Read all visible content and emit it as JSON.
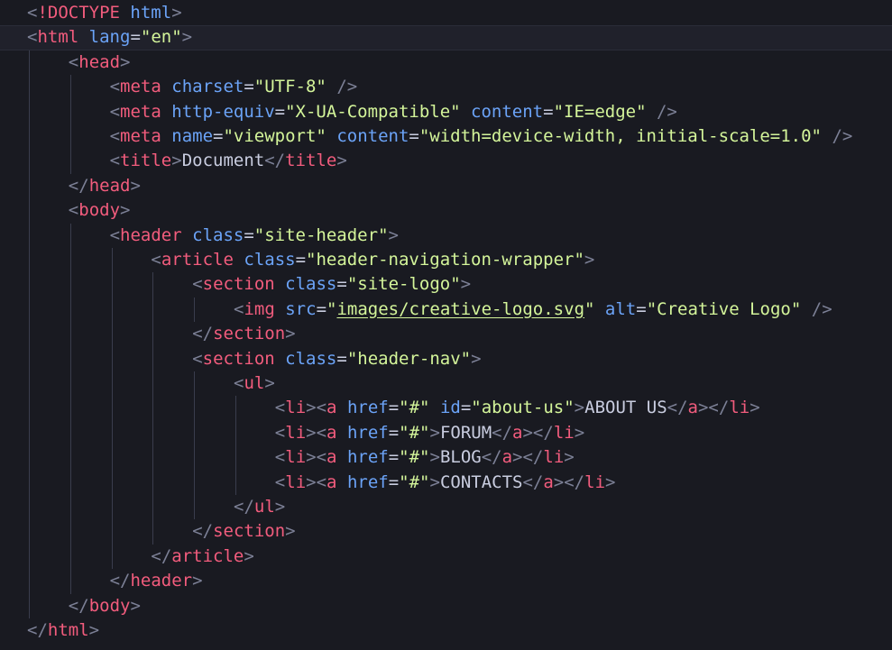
{
  "editor": {
    "language": "html",
    "active_line": 1,
    "colors": {
      "background": "#191a21",
      "tag": "#f25c7d",
      "attribute": "#6ba3f7",
      "string": "#d4f59a",
      "text": "#c9cde0",
      "punctuation": "#7c8096"
    },
    "lines": [
      {
        "indent": 0,
        "tokens": [
          [
            "punct",
            "<"
          ],
          [
            "tag",
            "!DOCTYPE"
          ],
          [
            "txt",
            " "
          ],
          [
            "attr",
            "html"
          ],
          [
            "punct",
            ">"
          ]
        ]
      },
      {
        "indent": 0,
        "tokens": [
          [
            "punct",
            "<"
          ],
          [
            "tag",
            "html"
          ],
          [
            "txt",
            " "
          ],
          [
            "attr",
            "lang"
          ],
          [
            "eq",
            "="
          ],
          [
            "str",
            "\"en\""
          ],
          [
            "punct",
            ">"
          ]
        ]
      },
      {
        "indent": 1,
        "tokens": [
          [
            "punct",
            "<"
          ],
          [
            "tag",
            "head"
          ],
          [
            "punct",
            ">"
          ]
        ]
      },
      {
        "indent": 2,
        "tokens": [
          [
            "punct",
            "<"
          ],
          [
            "tag",
            "meta"
          ],
          [
            "txt",
            " "
          ],
          [
            "attr",
            "charset"
          ],
          [
            "eq",
            "="
          ],
          [
            "str",
            "\"UTF-8\""
          ],
          [
            "txt",
            " "
          ],
          [
            "punct",
            "/>"
          ]
        ]
      },
      {
        "indent": 2,
        "tokens": [
          [
            "punct",
            "<"
          ],
          [
            "tag",
            "meta"
          ],
          [
            "txt",
            " "
          ],
          [
            "attr",
            "http-equiv"
          ],
          [
            "eq",
            "="
          ],
          [
            "str",
            "\"X-UA-Compatible\""
          ],
          [
            "txt",
            " "
          ],
          [
            "attr",
            "content"
          ],
          [
            "eq",
            "="
          ],
          [
            "str",
            "\"IE=edge\""
          ],
          [
            "txt",
            " "
          ],
          [
            "punct",
            "/>"
          ]
        ]
      },
      {
        "indent": 2,
        "tokens": [
          [
            "punct",
            "<"
          ],
          [
            "tag",
            "meta"
          ],
          [
            "txt",
            " "
          ],
          [
            "attr",
            "name"
          ],
          [
            "eq",
            "="
          ],
          [
            "str",
            "\"viewport\""
          ],
          [
            "txt",
            " "
          ],
          [
            "attr",
            "content"
          ],
          [
            "eq",
            "="
          ],
          [
            "str",
            "\"width=device-width, initial-scale=1.0\""
          ],
          [
            "txt",
            " "
          ],
          [
            "punct",
            "/>"
          ]
        ]
      },
      {
        "indent": 2,
        "tokens": [
          [
            "punct",
            "<"
          ],
          [
            "tag",
            "title"
          ],
          [
            "punct",
            ">"
          ],
          [
            "txt",
            "Document"
          ],
          [
            "punct",
            "</"
          ],
          [
            "tag",
            "title"
          ],
          [
            "punct",
            ">"
          ]
        ]
      },
      {
        "indent": 1,
        "tokens": [
          [
            "punct",
            "</"
          ],
          [
            "tag",
            "head"
          ],
          [
            "punct",
            ">"
          ]
        ]
      },
      {
        "indent": 1,
        "tokens": [
          [
            "punct",
            "<"
          ],
          [
            "tag",
            "body"
          ],
          [
            "punct",
            ">"
          ]
        ]
      },
      {
        "indent": 2,
        "tokens": [
          [
            "punct",
            "<"
          ],
          [
            "tag",
            "header"
          ],
          [
            "txt",
            " "
          ],
          [
            "attr",
            "class"
          ],
          [
            "eq",
            "="
          ],
          [
            "str",
            "\"site-header\""
          ],
          [
            "punct",
            ">"
          ]
        ]
      },
      {
        "indent": 3,
        "tokens": [
          [
            "punct",
            "<"
          ],
          [
            "tag",
            "article"
          ],
          [
            "txt",
            " "
          ],
          [
            "attr",
            "class"
          ],
          [
            "eq",
            "="
          ],
          [
            "str",
            "\"header-navigation-wrapper\""
          ],
          [
            "punct",
            ">"
          ]
        ]
      },
      {
        "indent": 4,
        "tokens": [
          [
            "punct",
            "<"
          ],
          [
            "tag",
            "section"
          ],
          [
            "txt",
            " "
          ],
          [
            "attr",
            "class"
          ],
          [
            "eq",
            "="
          ],
          [
            "str",
            "\"site-logo\""
          ],
          [
            "punct",
            ">"
          ]
        ]
      },
      {
        "indent": 5,
        "tokens": [
          [
            "punct",
            "<"
          ],
          [
            "tag",
            "img"
          ],
          [
            "txt",
            " "
          ],
          [
            "attr",
            "src"
          ],
          [
            "eq",
            "="
          ],
          [
            "str",
            "\""
          ],
          [
            "url",
            "images/creative-logo.svg"
          ],
          [
            "str",
            "\""
          ],
          [
            "txt",
            " "
          ],
          [
            "attr",
            "alt"
          ],
          [
            "eq",
            "="
          ],
          [
            "str",
            "\"Creative Logo\""
          ],
          [
            "txt",
            " "
          ],
          [
            "punct",
            "/>"
          ]
        ]
      },
      {
        "indent": 4,
        "tokens": [
          [
            "punct",
            "</"
          ],
          [
            "tag",
            "section"
          ],
          [
            "punct",
            ">"
          ]
        ]
      },
      {
        "indent": 4,
        "tokens": [
          [
            "punct",
            "<"
          ],
          [
            "tag",
            "section"
          ],
          [
            "txt",
            " "
          ],
          [
            "attr",
            "class"
          ],
          [
            "eq",
            "="
          ],
          [
            "str",
            "\"header-nav\""
          ],
          [
            "punct",
            ">"
          ]
        ]
      },
      {
        "indent": 5,
        "tokens": [
          [
            "punct",
            "<"
          ],
          [
            "tag",
            "ul"
          ],
          [
            "punct",
            ">"
          ]
        ]
      },
      {
        "indent": 6,
        "tokens": [
          [
            "punct",
            "<"
          ],
          [
            "tag",
            "li"
          ],
          [
            "punct",
            "><"
          ],
          [
            "tag",
            "a"
          ],
          [
            "txt",
            " "
          ],
          [
            "attr",
            "href"
          ],
          [
            "eq",
            "="
          ],
          [
            "str",
            "\"#\""
          ],
          [
            "txt",
            " "
          ],
          [
            "attr",
            "id"
          ],
          [
            "eq",
            "="
          ],
          [
            "str",
            "\"about-us\""
          ],
          [
            "punct",
            ">"
          ],
          [
            "txt",
            "ABOUT US"
          ],
          [
            "punct",
            "</"
          ],
          [
            "tag",
            "a"
          ],
          [
            "punct",
            "></"
          ],
          [
            "tag",
            "li"
          ],
          [
            "punct",
            ">"
          ]
        ]
      },
      {
        "indent": 6,
        "tokens": [
          [
            "punct",
            "<"
          ],
          [
            "tag",
            "li"
          ],
          [
            "punct",
            "><"
          ],
          [
            "tag",
            "a"
          ],
          [
            "txt",
            " "
          ],
          [
            "attr",
            "href"
          ],
          [
            "eq",
            "="
          ],
          [
            "str",
            "\"#\""
          ],
          [
            "punct",
            ">"
          ],
          [
            "txt",
            "FORUM"
          ],
          [
            "punct",
            "</"
          ],
          [
            "tag",
            "a"
          ],
          [
            "punct",
            "></"
          ],
          [
            "tag",
            "li"
          ],
          [
            "punct",
            ">"
          ]
        ]
      },
      {
        "indent": 6,
        "tokens": [
          [
            "punct",
            "<"
          ],
          [
            "tag",
            "li"
          ],
          [
            "punct",
            "><"
          ],
          [
            "tag",
            "a"
          ],
          [
            "txt",
            " "
          ],
          [
            "attr",
            "href"
          ],
          [
            "eq",
            "="
          ],
          [
            "str",
            "\"#\""
          ],
          [
            "punct",
            ">"
          ],
          [
            "txt",
            "BLOG"
          ],
          [
            "punct",
            "</"
          ],
          [
            "tag",
            "a"
          ],
          [
            "punct",
            "></"
          ],
          [
            "tag",
            "li"
          ],
          [
            "punct",
            ">"
          ]
        ]
      },
      {
        "indent": 6,
        "tokens": [
          [
            "punct",
            "<"
          ],
          [
            "tag",
            "li"
          ],
          [
            "punct",
            "><"
          ],
          [
            "tag",
            "a"
          ],
          [
            "txt",
            " "
          ],
          [
            "attr",
            "href"
          ],
          [
            "eq",
            "="
          ],
          [
            "str",
            "\"#\""
          ],
          [
            "punct",
            ">"
          ],
          [
            "txt",
            "CONTACTS"
          ],
          [
            "punct",
            "</"
          ],
          [
            "tag",
            "a"
          ],
          [
            "punct",
            "></"
          ],
          [
            "tag",
            "li"
          ],
          [
            "punct",
            ">"
          ]
        ]
      },
      {
        "indent": 5,
        "tokens": [
          [
            "punct",
            "</"
          ],
          [
            "tag",
            "ul"
          ],
          [
            "punct",
            ">"
          ]
        ]
      },
      {
        "indent": 4,
        "tokens": [
          [
            "punct",
            "</"
          ],
          [
            "tag",
            "section"
          ],
          [
            "punct",
            ">"
          ]
        ]
      },
      {
        "indent": 3,
        "tokens": [
          [
            "punct",
            "</"
          ],
          [
            "tag",
            "article"
          ],
          [
            "punct",
            ">"
          ]
        ]
      },
      {
        "indent": 2,
        "tokens": [
          [
            "punct",
            "</"
          ],
          [
            "tag",
            "header"
          ],
          [
            "punct",
            ">"
          ]
        ]
      },
      {
        "indent": 1,
        "tokens": [
          [
            "punct",
            "</"
          ],
          [
            "tag",
            "body"
          ],
          [
            "punct",
            ">"
          ]
        ]
      },
      {
        "indent": 0,
        "tokens": [
          [
            "punct",
            "</"
          ],
          [
            "tag",
            "html"
          ],
          [
            "punct",
            ">"
          ]
        ]
      }
    ]
  }
}
